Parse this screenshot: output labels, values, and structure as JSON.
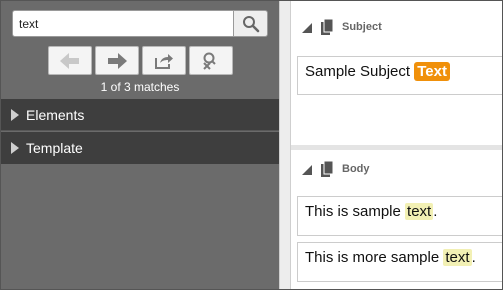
{
  "search": {
    "value": "text",
    "result_text": "1 of 3 matches"
  },
  "toolbar": {
    "icons": [
      "arrow-left-icon",
      "arrow-right-icon",
      "share-icon",
      "clear-search-icon"
    ]
  },
  "tree": {
    "items": [
      {
        "label": "Elements"
      },
      {
        "label": "Template"
      }
    ]
  },
  "sections": {
    "subject": {
      "title": "Subject",
      "text_before": "Sample Subject ",
      "match": "Text"
    },
    "body": {
      "title": "Body",
      "line1_before": "This is sample ",
      "line1_match": "text",
      "line1_after": ".",
      "line2_before": "This is more sample ",
      "line2_match": "text",
      "line2_after": "."
    }
  },
  "colors": {
    "panel_dark": "#6b6b6b",
    "tree_row": "#3e3e3e",
    "current_match": "#f0900a",
    "other_match": "#f2f0b4"
  }
}
